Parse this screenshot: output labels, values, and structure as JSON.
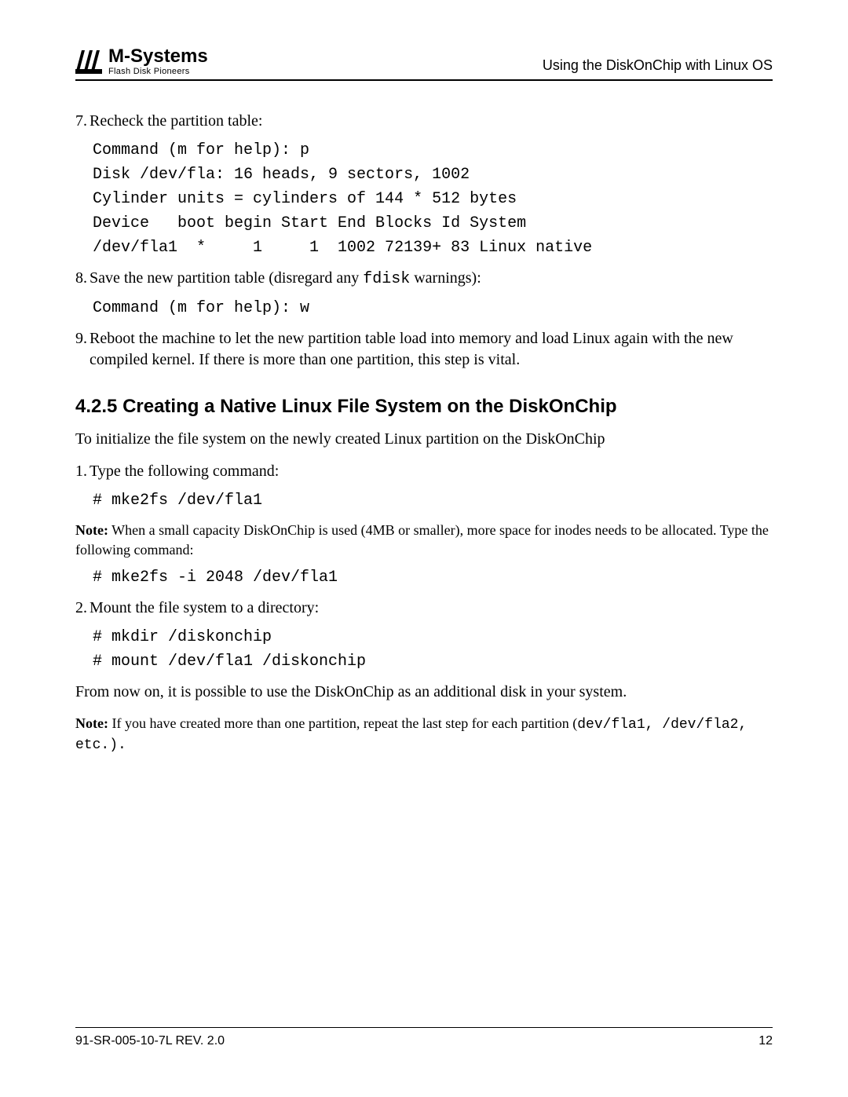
{
  "header": {
    "logo_main": "M-Systems",
    "logo_tag": "Flash Disk Pioneers",
    "doc_title": "Using the DiskOnChip with Linux OS"
  },
  "step7": {
    "num": "7.",
    "text": "Recheck the partition table:",
    "code": "Command (m for help): p\nDisk /dev/fla: 16 heads, 9 sectors, 1002\nCylinder units = cylinders of 144 * 512 bytes\nDevice   boot begin Start End Blocks Id System\n/dev/fla1  *     1     1  1002 72139+ 83 Linux native"
  },
  "step8": {
    "num": "8.",
    "text_before": "Save the new partition table (disregard any ",
    "inline_code": "fdisk",
    "text_after": " warnings):",
    "code": "Command (m for help): w"
  },
  "step9": {
    "num": "9.",
    "text": "Reboot the machine to let the new partition table load into memory and load Linux again with the new compiled kernel. If there is more than one partition, this step is vital."
  },
  "section": {
    "number": "4.2.5",
    "title": "Creating a Native Linux File System on the DiskOnChip",
    "intro": "To initialize the file system on the newly created Linux partition on the DiskOnChip"
  },
  "s_step1": {
    "num": "1.",
    "text": "Type the following command:",
    "code": "# mke2fs /dev/fla1"
  },
  "note1": {
    "label": "Note:",
    "text": " When a small capacity DiskOnChip is used (4MB or smaller), more space for inodes needs to be allocated. Type the following command:",
    "code": "# mke2fs -i 2048 /dev/fla1"
  },
  "s_step2": {
    "num": "2.",
    "text": "Mount the file system to a directory:",
    "code": "# mkdir /diskonchip\n# mount /dev/fla1 /diskonchip"
  },
  "closing": "From now on, it is possible to use the DiskOnChip as an additional disk in your system.",
  "note2": {
    "label": "Note:",
    "text_before": " If you have created more than one partition, repeat the last step for each partition (",
    "inline_code": "dev/fla1, /dev/fla2, etc.).",
    "text_after": ""
  },
  "footer": {
    "left": "91-SR-005-10-7L REV. 2.0",
    "right": "12"
  }
}
